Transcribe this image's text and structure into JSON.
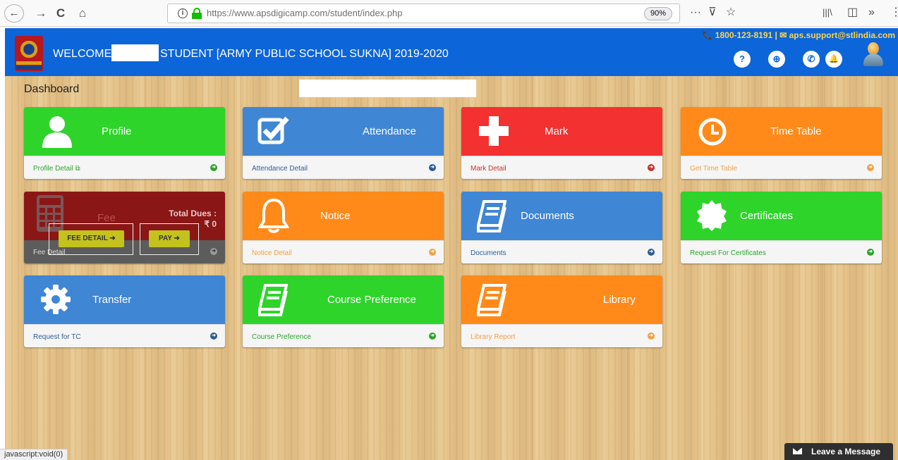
{
  "browser": {
    "back": "←",
    "forward": "→",
    "reload": "C",
    "home": "⌂",
    "url": "https://www.apsdigicamp.com/student/index.php",
    "zoom": "90%",
    "menu_dots": "···",
    "pocket": "⊽",
    "star": "☆",
    "library": "|||\\",
    "sidebar": "◫",
    "overflow": "»",
    "more": "⋮"
  },
  "header": {
    "welcome": "WELCOME",
    "school": "STUDENT [ARMY PUBLIC SCHOOL SUKNA] 2019-2020",
    "contact": "📞 1800-123-8191 | ✉ aps.support@stlindia.com",
    "icons": {
      "help": "?",
      "support": "⊕",
      "phone": "✆",
      "bell": "🔔"
    },
    "brand_color": "#0c65d9"
  },
  "dashboard": {
    "title": "Dashboard"
  },
  "cards": {
    "profile": {
      "title": "Profile",
      "link": "Profile Detail",
      "ext": "⧉"
    },
    "attendance": {
      "title": "Attendance",
      "link": "Attendance Detail"
    },
    "mark": {
      "title": "Mark",
      "link": "Mark Detail"
    },
    "timetable": {
      "title": "Time Table",
      "link": "Get Time Table"
    },
    "fee": {
      "title": "Fee",
      "total_label": "Total Dues :",
      "total_value": "₹ 0",
      "link": "Fee Detail",
      "btn_detail": "FEE DETAIL ➜",
      "btn_pay": "PAY ➜"
    },
    "notice": {
      "title": "Notice",
      "link": "Notice Detail"
    },
    "documents": {
      "title": "Documents",
      "link": "Documents"
    },
    "certificates": {
      "title": "Certificates",
      "link": "Request For Certificates"
    },
    "transfer": {
      "title": "Transfer",
      "link": "Request for TC"
    },
    "course": {
      "title": "Course Preference",
      "link": "Course Preference"
    },
    "library": {
      "title": "Library",
      "link": "Library Report"
    }
  },
  "arrow": "➜",
  "status_bar": "javascript:void(0)",
  "chat": {
    "label": "Leave a Message"
  }
}
